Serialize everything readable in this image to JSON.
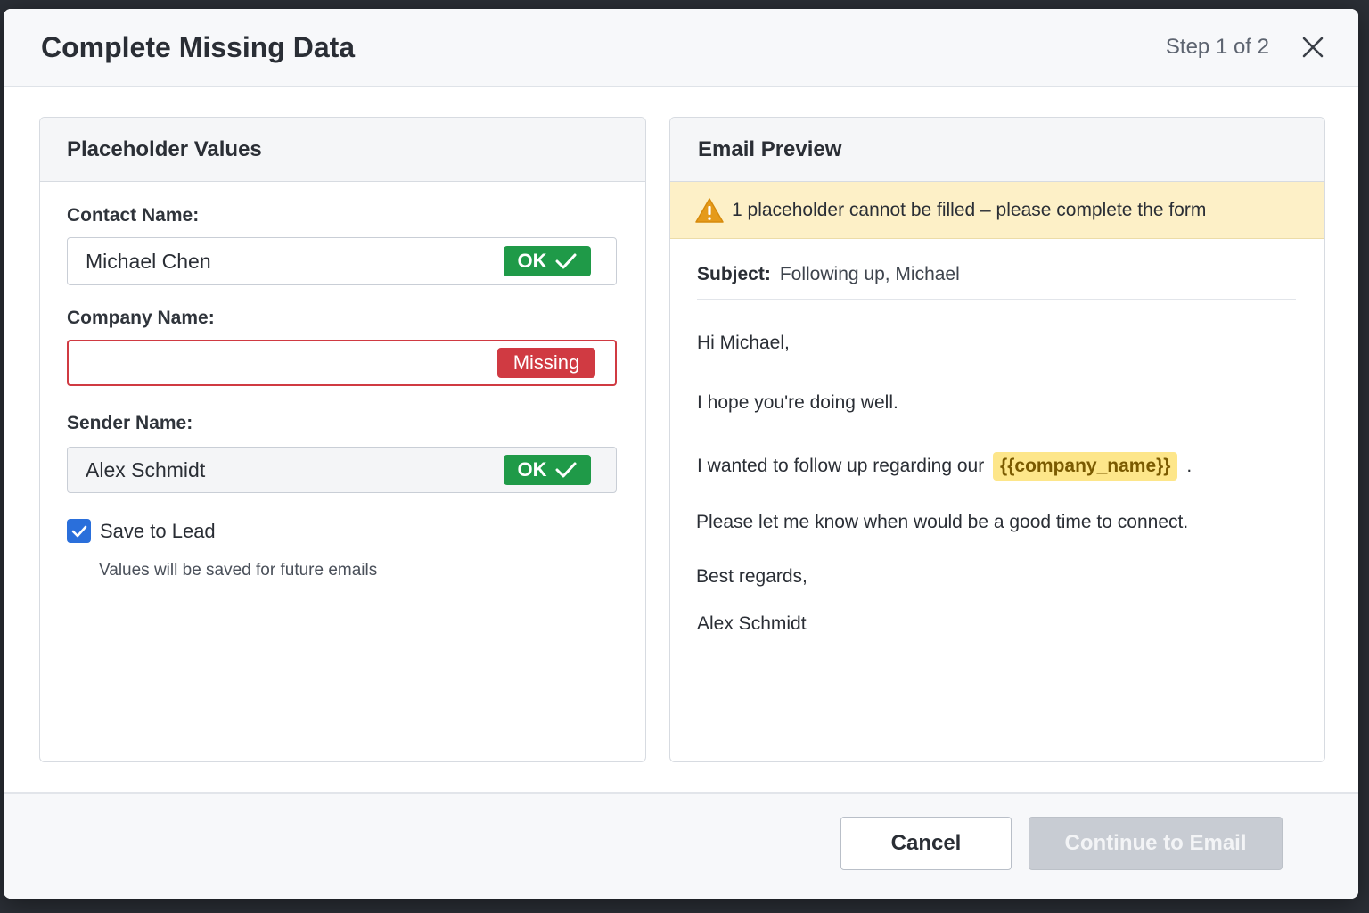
{
  "modal": {
    "title": "Complete Missing Data",
    "step": "Step 1 of 2"
  },
  "left_panel": {
    "title": "Placeholder Values",
    "fields": [
      {
        "label": "Contact Name:",
        "value": "Michael Chen",
        "status": "OK"
      },
      {
        "label": "Company Name:",
        "value": "",
        "status": "Missing"
      },
      {
        "label": "Sender Name:",
        "value": "Alex Schmidt",
        "status": "OK"
      }
    ],
    "save_checkbox": {
      "label": "Save to Lead",
      "checked": true
    },
    "hint": "Values will be saved for future emails"
  },
  "right_panel": {
    "title": "Email Preview",
    "warning": "1 placeholder cannot be filled – please complete the form",
    "subject_label": "Subject:",
    "subject_value": "Following up, Michael",
    "greeting": "Hi Michael,",
    "line1": "I hope you're doing well.",
    "line2_before": "I wanted to follow up regarding our",
    "line2_placeholder": "{{company_name}}",
    "line2_after": ".",
    "line3": "Please let me know when would be a good time to connect.",
    "signoff": "Best regards,",
    "signature": "Alex Schmidt"
  },
  "footer": {
    "cancel_label": "Cancel",
    "continue_label": "Continue to Email"
  },
  "colors": {
    "ok": "#1f9a48",
    "missing": "#d03a42",
    "warning_bg": "#fdf0c7",
    "accent": "#2a6fdb"
  },
  "icons": {
    "close": "close-icon",
    "check": "checkmark-icon",
    "warning": "warning-triangle-icon"
  }
}
